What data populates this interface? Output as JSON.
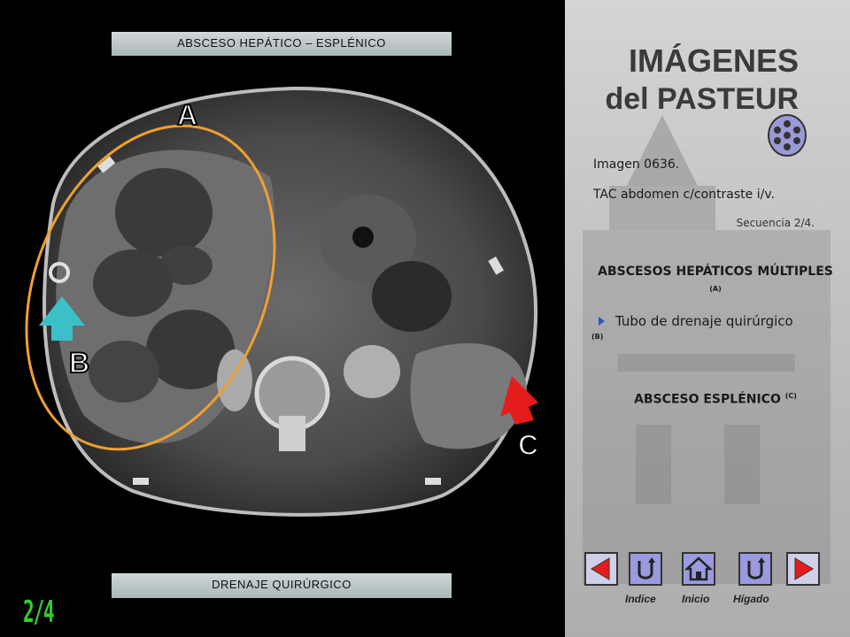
{
  "banners": {
    "top": "ABSCESO  HEPÁTICO – ESPLÉNICO",
    "bottom": "DRENAJE  QUIRÚRGICO"
  },
  "sequence_mark": "2/4",
  "labels": {
    "a": "A",
    "b": "B",
    "c": "C"
  },
  "brand": {
    "line1": "IMÁGENES",
    "line2": "del PASTEUR"
  },
  "info": {
    "image_number": "Imagen 0636.",
    "study": "TAC abdomen c/contraste i/v.",
    "sequence": "Secuencia  2/4."
  },
  "findings": {
    "heading1": "ABSCESOS HEPÁTICOS MÚLTIPLES",
    "heading1_sup": "(A)",
    "bullet": "Tubo de drenaje quirúrgico",
    "bullet_sup": "(B)",
    "heading2": "ABSCESO ESPLÉNICO",
    "heading2_sup": "(C)"
  },
  "nav": {
    "labels": {
      "index": "Indice",
      "home": "Inicio",
      "liver": "Hígado"
    },
    "icons": [
      "prev-triangle-icon",
      "return-icon",
      "home-icon",
      "return-icon",
      "next-triangle-icon"
    ]
  },
  "colors": {
    "ellipse": "#f0a030",
    "arrow_b": "#3cc0c8",
    "arrow_c": "#e51c1c",
    "seq": "#2fd02f",
    "nav_fill": "#9a9ae0",
    "nav_arrow": "#e51c1c"
  }
}
